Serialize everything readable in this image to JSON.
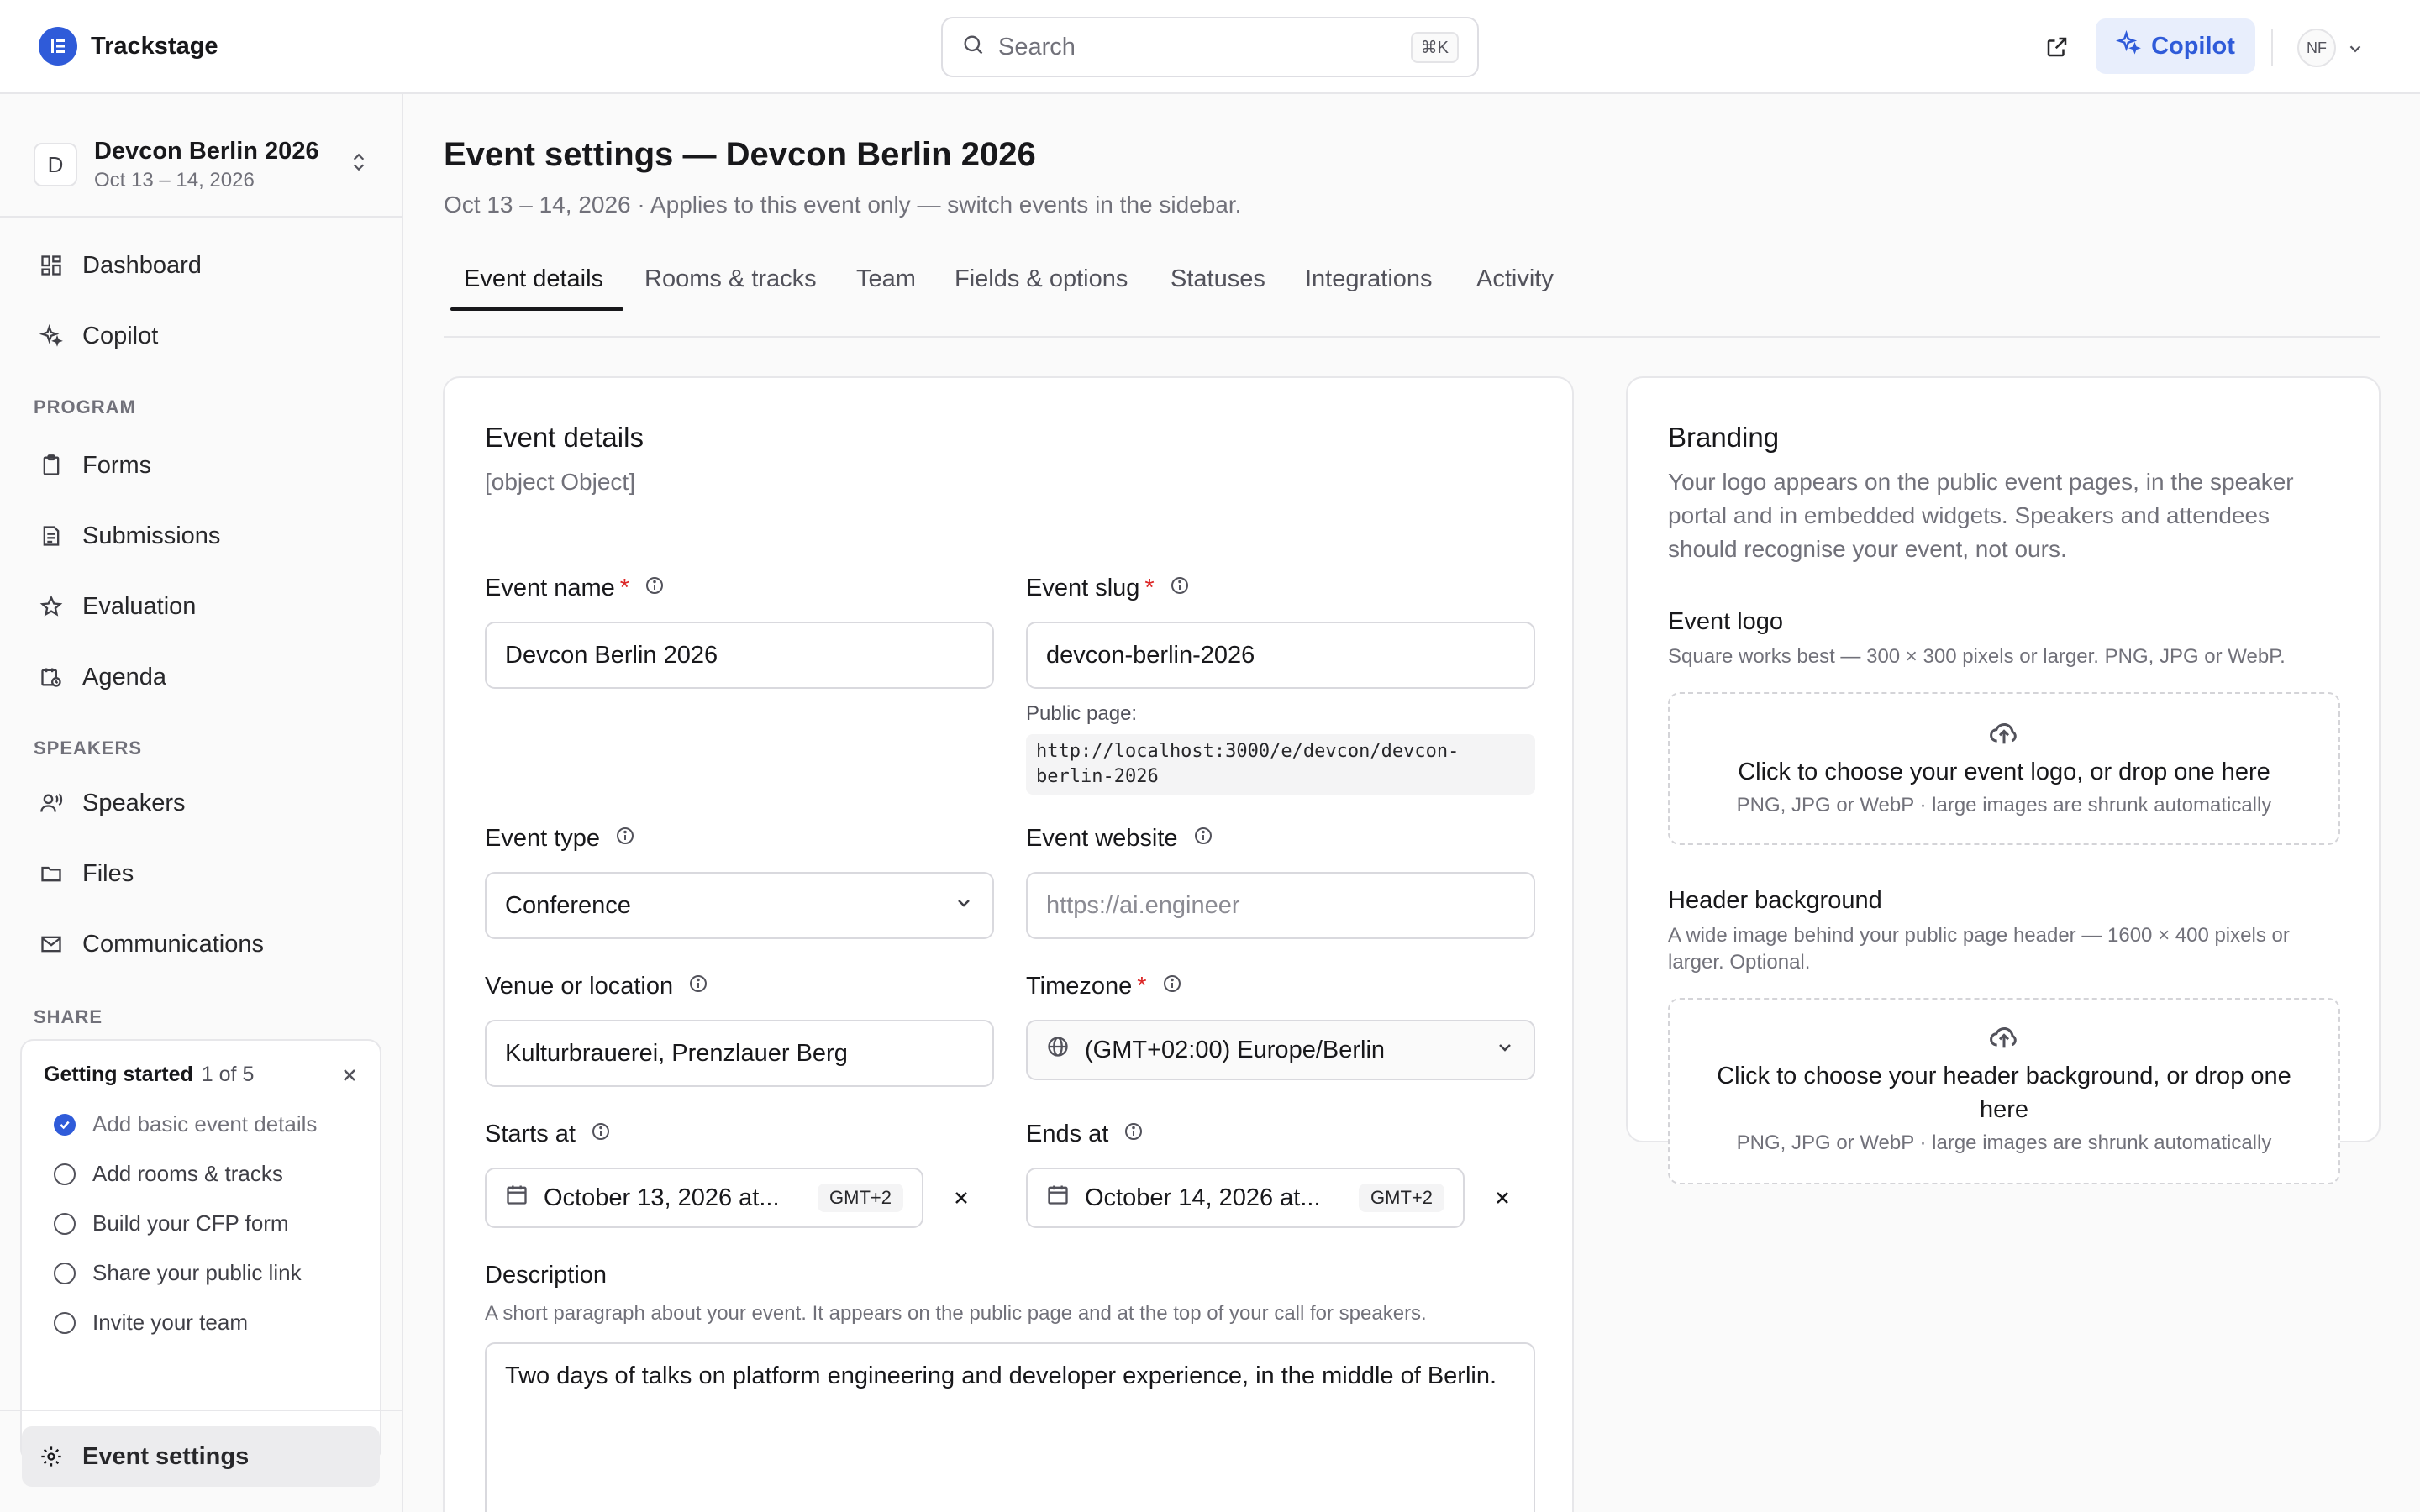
{
  "app": {
    "name": "Trackstage"
  },
  "search": {
    "placeholder": "Search",
    "shortcut": "⌘K"
  },
  "header": {
    "copilot_label": "Copilot",
    "avatar_initials": "NF"
  },
  "event_switcher": {
    "initial": "D",
    "name": "Devcon Berlin 2026",
    "dates": "Oct 13 – 14, 2026"
  },
  "sidebar": {
    "top_items": [
      {
        "label": "Dashboard"
      },
      {
        "label": "Copilot"
      }
    ],
    "program_section": "PROGRAM",
    "program_items": [
      {
        "label": "Forms"
      },
      {
        "label": "Submissions"
      },
      {
        "label": "Evaluation"
      },
      {
        "label": "Agenda"
      }
    ],
    "speakers_section": "SPEAKERS",
    "speakers_items": [
      {
        "label": "Speakers"
      },
      {
        "label": "Files"
      },
      {
        "label": "Communications"
      }
    ],
    "share_section": "SHARE",
    "getting_started": {
      "title": "Getting started",
      "progress": "1 of 5",
      "items": [
        {
          "label": "Add basic event details",
          "done": true
        },
        {
          "label": "Add rooms & tracks",
          "done": false
        },
        {
          "label": "Build your CFP form",
          "done": false
        },
        {
          "label": "Share your public link",
          "done": false
        },
        {
          "label": "Invite your team",
          "done": false
        }
      ]
    },
    "bottom_item": {
      "label": "Event settings"
    }
  },
  "page": {
    "title": "Event settings — Devcon Berlin 2026",
    "subtitle": "Oct 13 – 14, 2026 · Applies to this event only — switch events in the sidebar.",
    "tabs": [
      {
        "label": "Event details",
        "active": true
      },
      {
        "label": "Rooms & tracks"
      },
      {
        "label": "Team"
      },
      {
        "label": "Fields & options"
      },
      {
        "label": "Statuses"
      },
      {
        "label": "Integrations"
      },
      {
        "label": "Activity"
      }
    ]
  },
  "details_card": {
    "title": "Event details",
    "description": {
      "label": "Description",
      "help": "A short paragraph about your event. It appears on the public page and at the top of your call for speakers.",
      "value": "Two days of talks on platform engineering and developer experience, in the middle of Berlin."
    },
    "event_name": {
      "label": "Event name",
      "value": "Devcon Berlin 2026"
    },
    "event_slug": {
      "label": "Event slug",
      "value": "devcon-berlin-2026",
      "public_label": "Public page:",
      "public_url_line1": "http://localhost:3000/e/devcon/devcon-",
      "public_url_line2": "berlin-2026"
    },
    "event_type": {
      "label": "Event type",
      "value": "Conference"
    },
    "event_website": {
      "label": "Event website",
      "placeholder": "https://ai.engineer"
    },
    "venue": {
      "label": "Venue or location",
      "value": "Kulturbrauerei, Prenzlauer Berg"
    },
    "timezone": {
      "label": "Timezone",
      "value": "(GMT+02:00) Europe/Berlin"
    },
    "starts_at": {
      "label": "Starts at",
      "value": "October 13, 2026 at...",
      "tz": "GMT+2"
    },
    "ends_at": {
      "label": "Ends at",
      "value": "October 14, 2026 at...",
      "tz": "GMT+2"
    }
  },
  "branding_card": {
    "title": "Branding",
    "description": "Your logo appears on the public event pages, in the speaker portal and in embedded widgets. Speakers and attendees should recognise your event, not ours.",
    "logo": {
      "title": "Event logo",
      "help": "Square works best — 300 × 300 pixels or larger. PNG, JPG or WebP.",
      "drop_main": "Click to choose your event logo, or drop one here",
      "drop_sub": "PNG, JPG or WebP · large images are shrunk automatically"
    },
    "header_bg": {
      "title": "Header background",
      "help": "A wide image behind your public page header — 1600 × 400 pixels or larger. Optional.",
      "drop_main": "Click to choose your header background, or drop one here",
      "drop_sub": "PNG, JPG or WebP · large images are shrunk automatically"
    }
  },
  "colors": {
    "accent": "#2f5bd9",
    "required": "#dc2626"
  }
}
